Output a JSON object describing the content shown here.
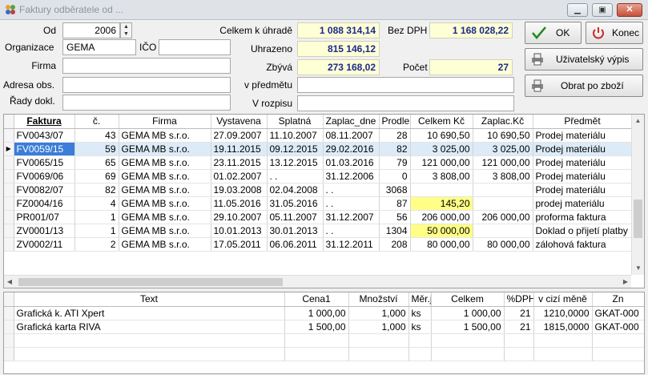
{
  "window": {
    "title": "Faktury odběratele od ..."
  },
  "form": {
    "od_label": "Od",
    "od_value": "2006",
    "organizace_label": "Organizace",
    "organizace_value": "GEMA",
    "ico_label": "IČO",
    "ico_value": "",
    "firma_label": "Firma",
    "firma_value": "",
    "adresa_label": "Adresa obs.",
    "adresa_value": "",
    "rady_label": "Řady dokl.",
    "rady_value": "",
    "celkem_label": "Celkem k úhradě",
    "celkem_value": "1 088 314,14",
    "uhrazeno_label": "Uhrazeno",
    "uhrazeno_value": "815 146,12",
    "zbyva_label": "Zbývá",
    "zbyva_value": "273 168,02",
    "bezdph_label": "Bez DPH",
    "bezdph_value": "1 168 028,22",
    "pocet_label": "Počet",
    "pocet_value": "27",
    "vpredmetu_label": "v předmětu",
    "vpredmetu_value": "",
    "vrozpisu_label": "V rozpisu",
    "vrozpisu_value": ""
  },
  "buttons": {
    "ok": "OK",
    "konec": "Konec",
    "uzivatelsky": "Uživatelský výpis",
    "obrat": "Obrat po zboží"
  },
  "invoice_table": {
    "columns": [
      "Faktura",
      "č.",
      "Firma",
      "Vystavena",
      "Splatná",
      "Zaplac_dne",
      "Prodlen",
      "Celkem Kč",
      "Zaplac.Kč",
      "Předmět"
    ],
    "rows": [
      [
        "FV0043/07",
        "43",
        "GEMA MB s.r.o.",
        "27.09.2007",
        "11.10.2007",
        "08.11.2007",
        "28",
        "10 690,50",
        "10 690,50",
        "Prodej materiálu"
      ],
      [
        "FV0059/15",
        "59",
        "GEMA MB s.r.o.",
        "19.11.2015",
        "09.12.2015",
        "29.02.2016",
        "82",
        "3 025,00",
        "3 025,00",
        "Prodej materiálu"
      ],
      [
        "FV0065/15",
        "65",
        "GEMA MB s.r.o.",
        "23.11.2015",
        "13.12.2015",
        "01.03.2016",
        "79",
        "121 000,00",
        "121 000,00",
        "Prodej materiálu"
      ],
      [
        "FV0069/06",
        "69",
        "GEMA MB s.r.o.",
        "01.02.2007",
        ". .",
        "31.12.2006",
        "0",
        "3 808,00",
        "3 808,00",
        "Prodej materiálu"
      ],
      [
        "FV0082/07",
        "82",
        "GEMA MB s.r.o.",
        "19.03.2008",
        "02.04.2008",
        ". .",
        "3068",
        "",
        "",
        "Prodej materiálu"
      ],
      [
        "FZ0004/16",
        "4",
        "GEMA MB s.r.o.",
        "11.05.2016",
        "31.05.2016",
        ". .",
        "87",
        "145,20",
        "",
        "prodej materiálu"
      ],
      [
        "PR001/07",
        "1",
        "GEMA MB s.r.o.",
        "29.10.2007",
        "05.11.2007",
        "31.12.2007",
        "56",
        "206 000,00",
        "206 000,00",
        "proforma faktura"
      ],
      [
        "ZV0001/13",
        "1",
        "GEMA MB s.r.o.",
        "10.01.2013",
        "30.01.2013",
        ". .",
        "1304",
        "50 000,00",
        "",
        "Doklad o přijetí platby"
      ],
      [
        "ZV0002/11",
        "2",
        "GEMA MB s.r.o.",
        "17.05.2011",
        "06.06.2011",
        "31.12.2011",
        "208",
        "80 000,00",
        "80 000,00",
        "zálohová faktura"
      ]
    ]
  },
  "items_table": {
    "columns": [
      "Text",
      "Cena1",
      "Množství",
      "Měr.j.",
      "Celkem",
      "%DPH",
      "v cizí měně",
      "Zn"
    ],
    "rows": [
      [
        "Grafická k. ATI Xpert",
        "1 000,00",
        "1,000",
        "ks",
        "1 000,00",
        "21",
        "1210,0000",
        "GKAT-000"
      ],
      [
        "Grafická karta RIVA",
        "1 500,00",
        "1,000",
        "ks",
        "1 500,00",
        "21",
        "1815,0000",
        "GKAT-000"
      ]
    ]
  },
  "colors": {
    "accent_ok": "#1a8a1a",
    "accent_close": "#cc2a2a",
    "readonly_bg": "#ffffd6",
    "highlight": "#ffff88",
    "selection": "#dcebf7"
  }
}
